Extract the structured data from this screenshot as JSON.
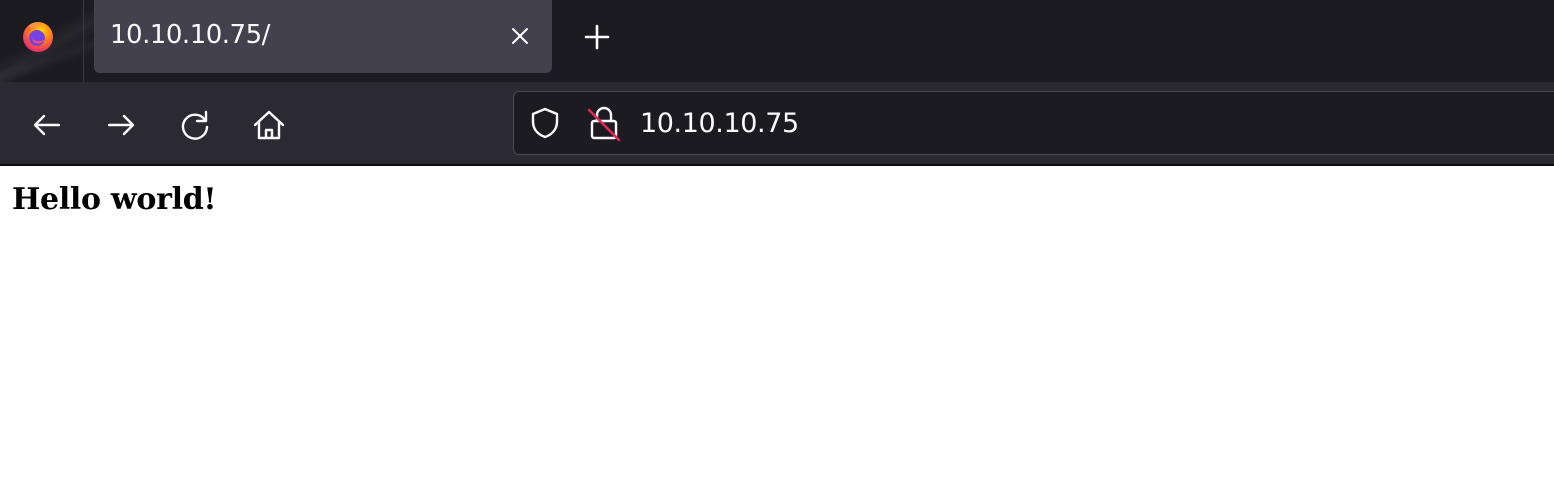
{
  "browser": {
    "logo_icon": "firefox-logo-icon",
    "tab": {
      "title": "10.10.10.75/",
      "close_icon": "close-icon"
    },
    "new_tab_icon": "plus-icon",
    "nav": {
      "back_icon": "arrow-left-icon",
      "forward_icon": "arrow-right-icon",
      "reload_icon": "reload-icon",
      "home_icon": "home-icon"
    },
    "urlbar": {
      "shield_icon": "shield-icon",
      "lock_icon": "insecure-lock-icon",
      "url": "10.10.10.75"
    },
    "colors": {
      "tabstrip_bg": "#1c1b22",
      "active_tab_bg": "#42414d",
      "toolbar_bg": "#2b2a33",
      "urlbar_bg": "#1c1b22",
      "insecure_slash": "#e22850"
    }
  },
  "page": {
    "heading": "Hello world!"
  }
}
